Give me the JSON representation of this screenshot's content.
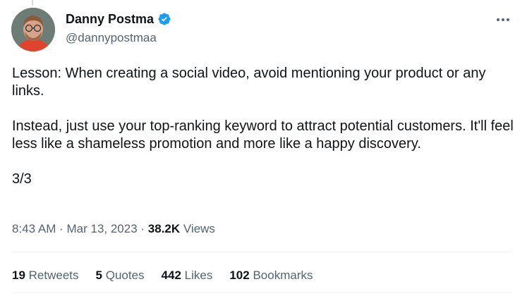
{
  "author": {
    "display_name": "Danny Postma",
    "handle": "@dannypostmaa",
    "verified_icon": "verified-badge-icon",
    "verified_color": "#1d9bf0"
  },
  "tweet": {
    "paragraphs": [
      "Lesson: When creating a social video, avoid mentioning your product or any links.",
      "Instead, just use your top-ranking keyword to attract potential customers. It'll feel less like a shameless promotion and more like a happy discovery.",
      "3/3"
    ]
  },
  "meta": {
    "time": "8:43 AM",
    "separator": " · ",
    "date": "Mar 13, 2023",
    "views_count": "38.2K",
    "views_label": "Views"
  },
  "stats": [
    {
      "count": "19",
      "label": "Retweets"
    },
    {
      "count": "5",
      "label": "Quotes"
    },
    {
      "count": "442",
      "label": "Likes"
    },
    {
      "count": "102",
      "label": "Bookmarks"
    }
  ],
  "more_icon": "more-options-icon"
}
